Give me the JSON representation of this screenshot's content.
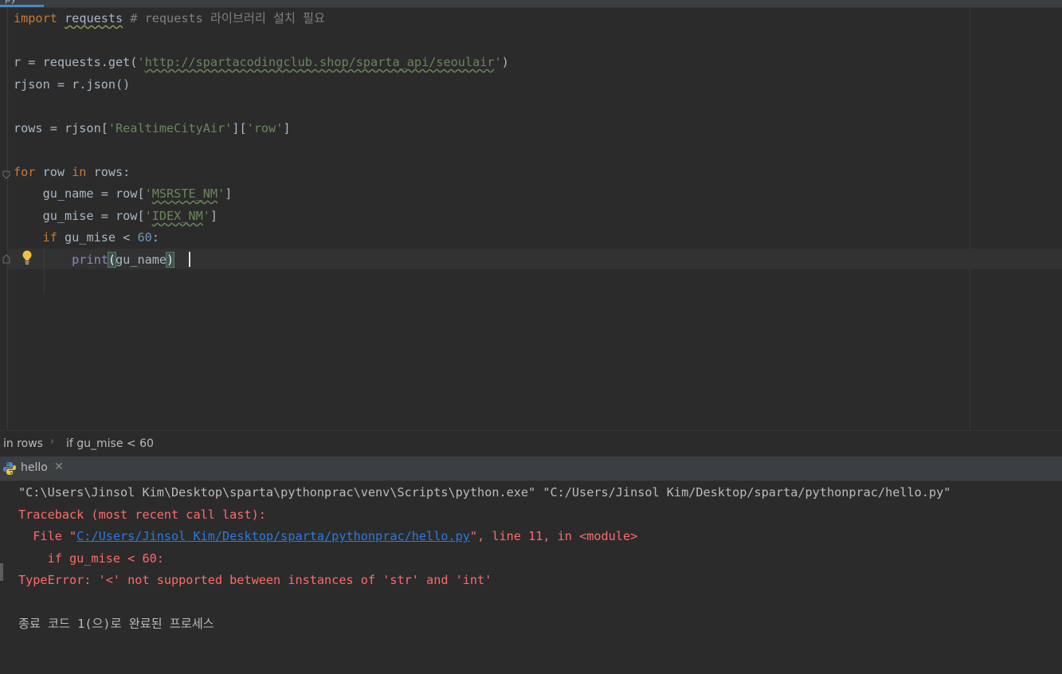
{
  "editor_tab": {
    "label": "py"
  },
  "code": {
    "l1": {
      "import": "import",
      "mod": "requests",
      "comment": "# requests 라이브러리 설치 필요"
    },
    "l3": {
      "pre": "r = requests.get(",
      "q1": "'",
      "url": "http://spartacodingclub.shop/sparta_api/seoulair",
      "q2": "'",
      "post": ")"
    },
    "l4": {
      "text": "rjson = r.json()"
    },
    "l6": {
      "pre": "rows = rjson[",
      "s1": "'RealtimeCityAir'",
      "mid": "][",
      "s2": "'row'",
      "post": "]"
    },
    "l8": {
      "kw_for": "for",
      "var": " row ",
      "kw_in": "in",
      "post": " rows:"
    },
    "l9": {
      "pre": "    gu_name = row[",
      "q1": "'",
      "s": "MSRSTE_NM",
      "q2": "'",
      "post": "]"
    },
    "l10": {
      "pre": "    gu_mise = row[",
      "q1": "'",
      "s": "IDEX_NM",
      "q2": "'",
      "post": "]"
    },
    "l11": {
      "indent": "    ",
      "kw_if": "if",
      "mid": " gu_mise < ",
      "num": "60",
      "post": ":"
    },
    "l12": {
      "indent": "        ",
      "func": "print",
      "open": "(",
      "arg": "gu_name",
      "close": ")"
    }
  },
  "breadcrumb": {
    "item1": "in rows",
    "sep": "›",
    "item2": "if gu_mise < 60"
  },
  "run_panel": {
    "tab_label": "hello",
    "close": "✕"
  },
  "console": {
    "cmd": "\"C:\\Users\\Jinsol Kim\\Desktop\\sparta\\pythonprac\\venv\\Scripts\\python.exe\" \"C:/Users/Jinsol Kim/Desktop/sparta/pythonprac/hello.py\"",
    "traceback": "Traceback (most recent call last):",
    "file_pre": "  File \"",
    "file_link": "C:/Users/Jinsol Kim/Desktop/sparta/pythonprac/hello.py",
    "file_post": "\", line 11, in <module>",
    "src_line": "    if gu_mise < 60:",
    "error": "TypeError: '<' not supported between instances of 'str' and 'int'",
    "exit": "종료 코드 1(으)로 완료된 프로세스"
  }
}
